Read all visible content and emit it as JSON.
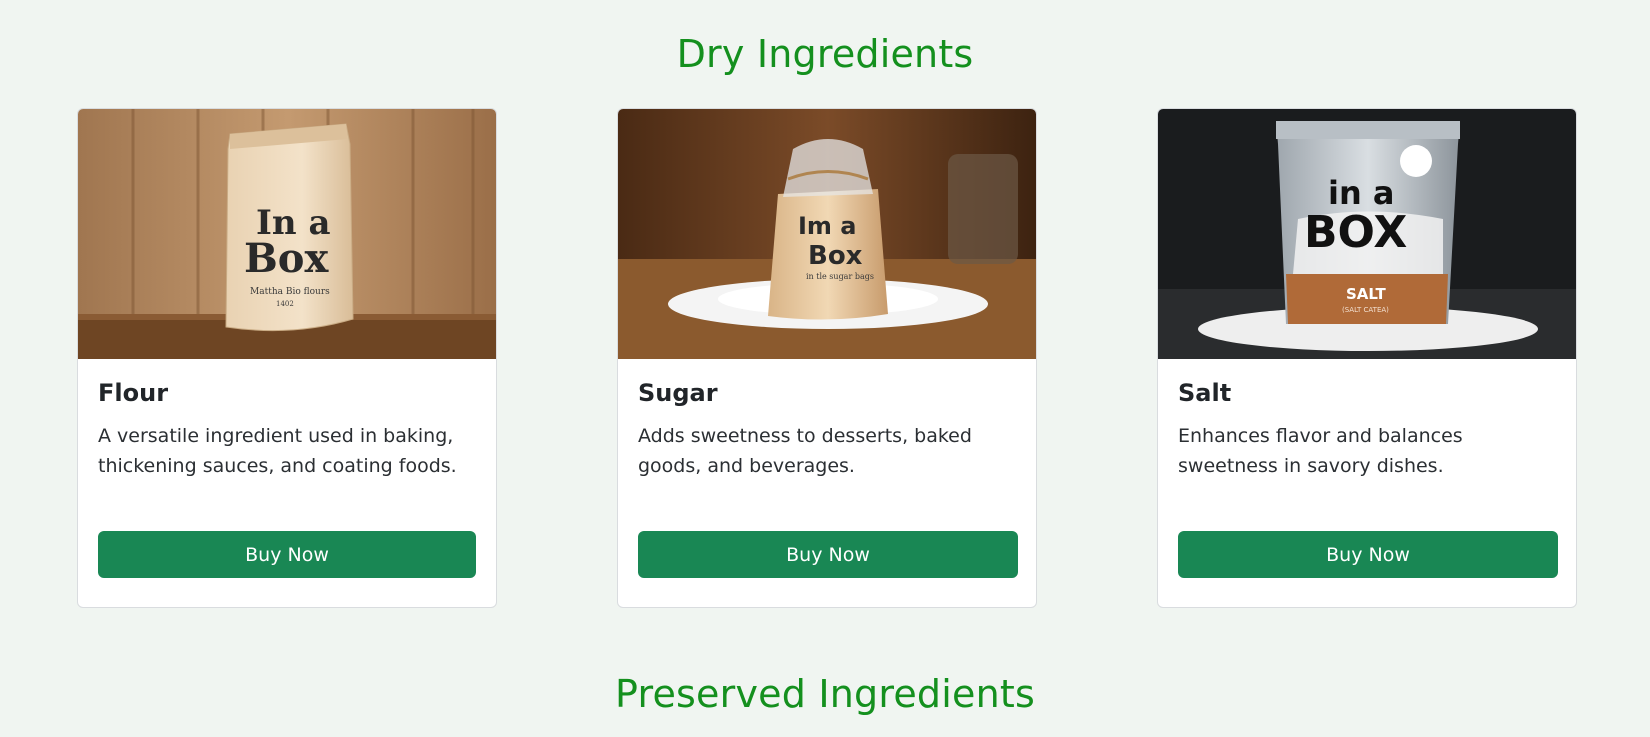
{
  "sections": [
    {
      "title": "Dry Ingredients"
    },
    {
      "title": "Preserved Ingredients"
    }
  ],
  "cards": [
    {
      "title": "Flour",
      "text": "A versatile ingredient used in baking, thickening sauces, and coating foods.",
      "button": "Buy Now",
      "image": {
        "bag_line1": "In a",
        "bag_line2": "Box",
        "bag_line3": "Mattha Bio flours",
        "bag_line4": "1402"
      }
    },
    {
      "title": "Sugar",
      "text": "Adds sweetness to desserts, baked goods, and beverages.",
      "button": "Buy Now",
      "image": {
        "bag_line1": "Im a",
        "bag_line2": "Box",
        "bag_line3": "in tle sugar bags"
      }
    },
    {
      "title": "Salt",
      "text": "Enhances flavor and balances sweetness in savory dishes.",
      "button": "Buy Now",
      "image": {
        "bag_line1": "in a",
        "bag_line2": "BOX",
        "bag_line3": "SALT",
        "bag_line4": "(SALT CATEA)"
      }
    }
  ],
  "colors": {
    "page_bg": "#f0f5f1",
    "heading": "#14901e",
    "button": "#198754"
  }
}
